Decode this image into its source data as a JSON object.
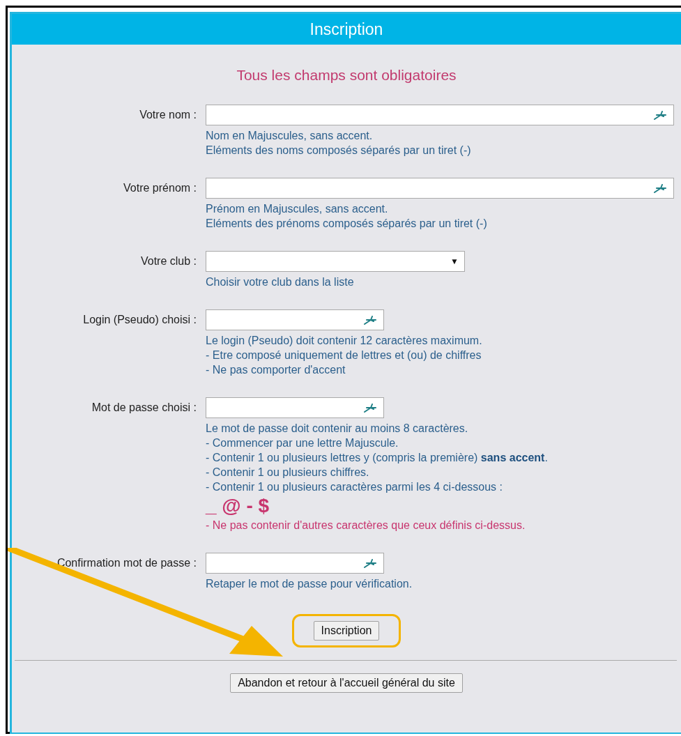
{
  "header": {
    "title": "Inscription"
  },
  "notice": "Tous les champs sont obligatoires",
  "fields": [
    {
      "kind": "wide",
      "label": "Votre nom :",
      "hints": [
        {
          "kind": "info",
          "text": "Nom en Majuscules, sans accent."
        },
        {
          "kind": "info",
          "text": "Eléments des noms composés séparés par un tiret (-)"
        }
      ]
    },
    {
      "kind": "wide",
      "label": "Votre prénom :",
      "hints": [
        {
          "kind": "info",
          "text": "Prénom en Majuscules, sans accent."
        },
        {
          "kind": "info",
          "text": "Eléments des prénoms composés séparés par un tiret (-)"
        }
      ]
    },
    {
      "kind": "select",
      "label": "Votre club :",
      "caret": "▼",
      "hints": [
        {
          "kind": "info",
          "text": "Choisir votre club dans la liste"
        }
      ]
    },
    {
      "kind": "short",
      "label": "Login (Pseudo) choisi :",
      "hints": [
        {
          "kind": "info",
          "text": "Le login (Pseudo) doit contenir 12 caractères maximum."
        },
        {
          "kind": "info",
          "text": "- Etre composé uniquement de lettres et (ou) de chiffres"
        },
        {
          "kind": "info",
          "text": "- Ne pas comporter d'accent"
        }
      ]
    },
    {
      "kind": "short",
      "label": "Mot de passe choisi :",
      "hints": [
        {
          "kind": "info",
          "text": "Le mot de passe doit contenir au moins 8 caractères."
        },
        {
          "kind": "info",
          "text": "- Commencer par une lettre Majuscule."
        },
        {
          "kind": "info",
          "text": "- Contenir 1 ou plusieurs lettres y (compris la première) **sans accent**."
        },
        {
          "kind": "info",
          "text": "- Contenir 1 ou plusieurs chiffres."
        },
        {
          "kind": "info",
          "text": "- Contenir 1 ou plusieurs caractères parmi les 4 ci-dessous :"
        },
        {
          "kind": "symbols",
          "text": "_ @ - $"
        },
        {
          "kind": "warning",
          "text": "- Ne pas contenir d'autres caractères que ceux définis ci-dessus."
        }
      ]
    },
    {
      "kind": "short",
      "label": "Confirmation mot de passe :",
      "hints": [
        {
          "kind": "info",
          "text": "Retaper le mot de passe pour vérification."
        }
      ]
    }
  ],
  "submit": {
    "label": "Inscription",
    "highlighted": true
  },
  "cancel": {
    "label": "Abandon et retour à l'accueil général du site"
  }
}
